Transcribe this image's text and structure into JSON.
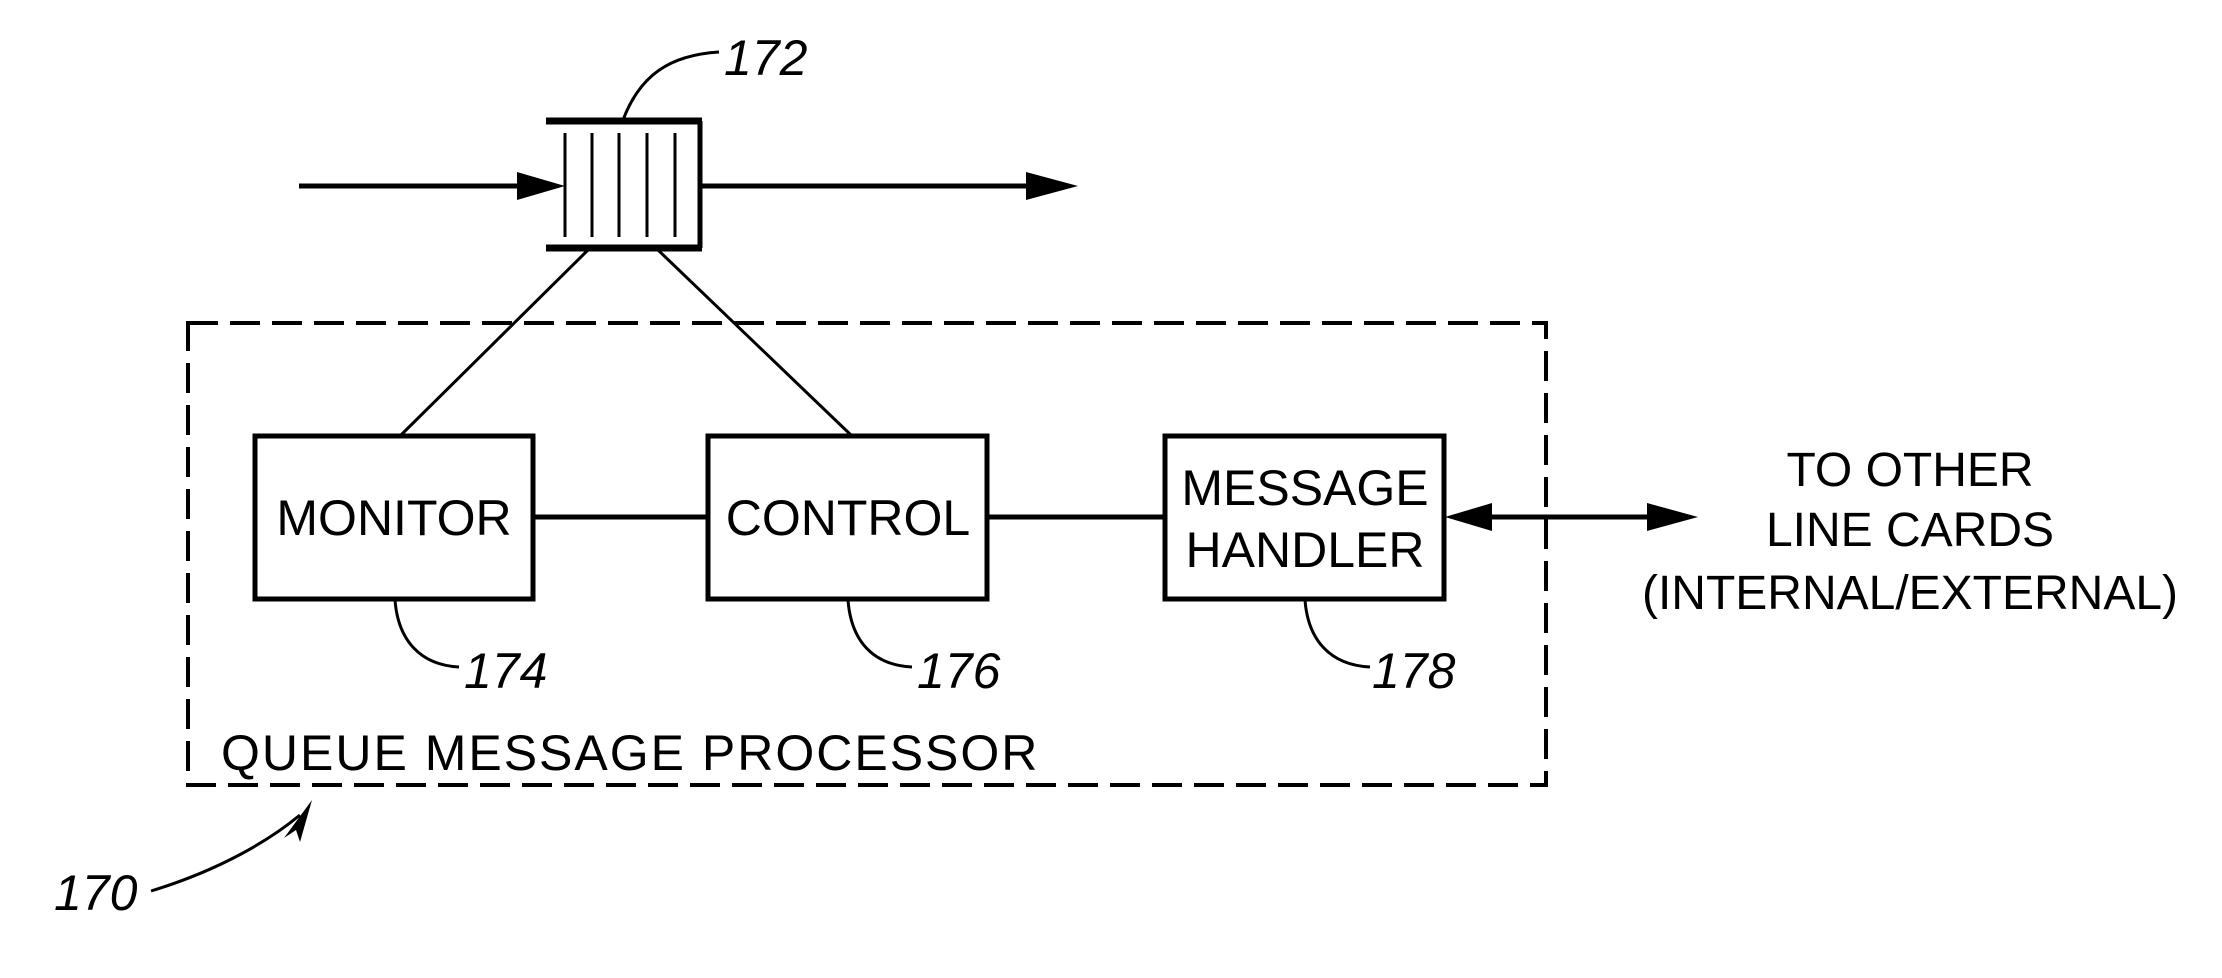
{
  "figure": {
    "queue": {
      "ref": "172",
      "slots": 5
    },
    "processor": {
      "ref": "170",
      "label": "QUEUE MESSAGE PROCESSOR"
    },
    "blocks": [
      {
        "id": "monitor",
        "label_lines": [
          "MONITOR"
        ],
        "ref": "174"
      },
      {
        "id": "control",
        "label_lines": [
          "CONTROL"
        ],
        "ref": "176"
      },
      {
        "id": "message-handler",
        "label_lines": [
          "MESSAGE",
          "HANDLER"
        ],
        "ref": "178"
      }
    ],
    "external": {
      "label_lines": [
        "TO OTHER",
        "LINE CARDS",
        "(INTERNAL/EXTERNAL)"
      ]
    }
  }
}
